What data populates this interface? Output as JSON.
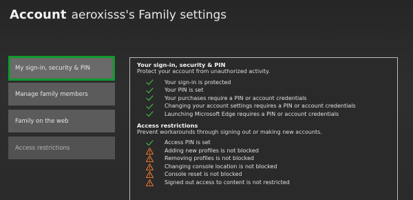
{
  "header": {
    "crumb": "Account",
    "title": "aeroxisss's Family settings"
  },
  "sidebar": {
    "items": [
      {
        "label": "My sign-in, security & PIN",
        "selected": true
      },
      {
        "label": "Manage family members",
        "selected": false
      },
      {
        "label": "Family on the web",
        "selected": false
      },
      {
        "label": "Access restrictions",
        "selected": false
      }
    ]
  },
  "panel": {
    "sections": [
      {
        "title": "Your sign-in, security & PIN",
        "description": "Protect your account from unauthorized activity.",
        "items": [
          {
            "status": "ok",
            "icon": "check-icon",
            "text": "Your sign-in is protected"
          },
          {
            "status": "ok",
            "icon": "check-icon",
            "text": "Your PIN is set"
          },
          {
            "status": "ok",
            "icon": "check-icon",
            "text": "Your purchases require a PIN or account credentials"
          },
          {
            "status": "ok",
            "icon": "check-icon",
            "text": "Changing your account settings requires a PIN or account credentials"
          },
          {
            "status": "ok",
            "icon": "check-icon",
            "text": "Launching Microsoft Edge requires a PIN or account credentials"
          }
        ]
      },
      {
        "title": "Access restrictions",
        "description": "Prevent workarounds through signing out or making new accounts.",
        "items": [
          {
            "status": "ok",
            "icon": "check-icon",
            "text": "Access PIN is set"
          },
          {
            "status": "warning",
            "icon": "warning-icon",
            "text": "Adding new profiles is not blocked"
          },
          {
            "status": "warning",
            "icon": "warning-icon",
            "text": "Removing profiles is not blocked"
          },
          {
            "status": "warning",
            "icon": "warning-icon",
            "text": "Changing console location is not blocked"
          },
          {
            "status": "warning",
            "icon": "warning-icon",
            "text": "Console reset is not blocked"
          },
          {
            "status": "warning",
            "icon": "warning-icon",
            "text": "Signed out access to content is not restricted"
          }
        ]
      }
    ]
  },
  "colors": {
    "background": "#2a2a2a",
    "nav_item": "#5b5b5b",
    "focus_outline": "#0e9a2e",
    "check": "#3fbf3f",
    "warning": "#e8742a",
    "panel_border": "#bdbdbd"
  }
}
